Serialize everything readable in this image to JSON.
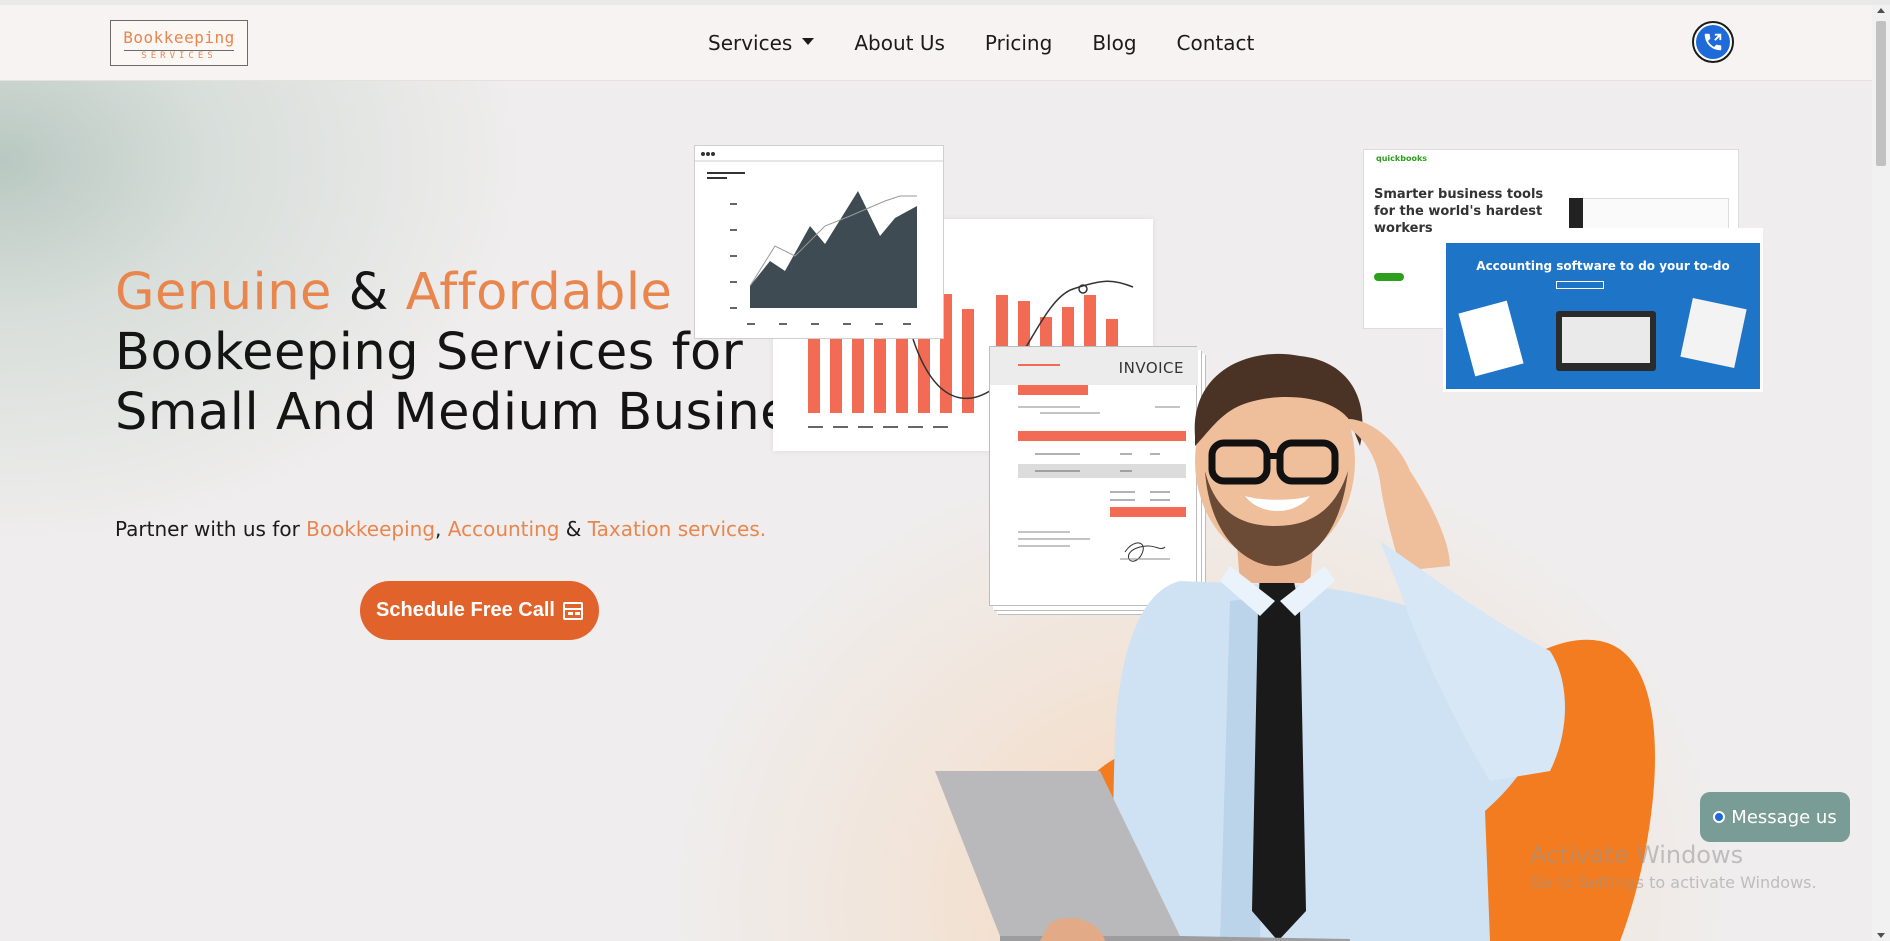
{
  "logo": {
    "title": "Bookkeeping",
    "subtitle": "SERVICES"
  },
  "nav": {
    "items": [
      {
        "label": "Services",
        "dropdown": true
      },
      {
        "label": "About Us"
      },
      {
        "label": "Pricing"
      },
      {
        "label": "Blog"
      },
      {
        "label": "Contact"
      }
    ],
    "phone_icon": "phone-icon"
  },
  "hero": {
    "line1_a": "Genuine",
    "line1_b": " & ",
    "line1_c": "Affordable",
    "line2": "Bookeeping Services for",
    "line3": "Small And Medium Businesses",
    "sub_prefix": "Partner with us for ",
    "sub_k1": "Bookkeeping",
    "sub_comma": ", ",
    "sub_k2": "Accounting",
    "sub_amp": " & ",
    "sub_k3": "Taxation services.",
    "cta_label": "Schedule Free Call",
    "cta_icon": "calendar-icon"
  },
  "illustration": {
    "invoice_title": "INVOICE",
    "qb_headline_1": "Smarter business tools",
    "qb_headline_2": "for the world's hardest",
    "qb_headline_3": "workers",
    "qb_banner": "Accounting software to do your to-do",
    "qb_logo": "quickbooks"
  },
  "overlay": {
    "watermark_title": "Activate Windows",
    "watermark_sub": "Go to Settings to activate Windows.",
    "message_label": "Message us"
  },
  "colors": {
    "accent": "#e8864e",
    "cta": "#e2622b",
    "chat": "#7a9c96",
    "phone": "#1e6ad9"
  }
}
